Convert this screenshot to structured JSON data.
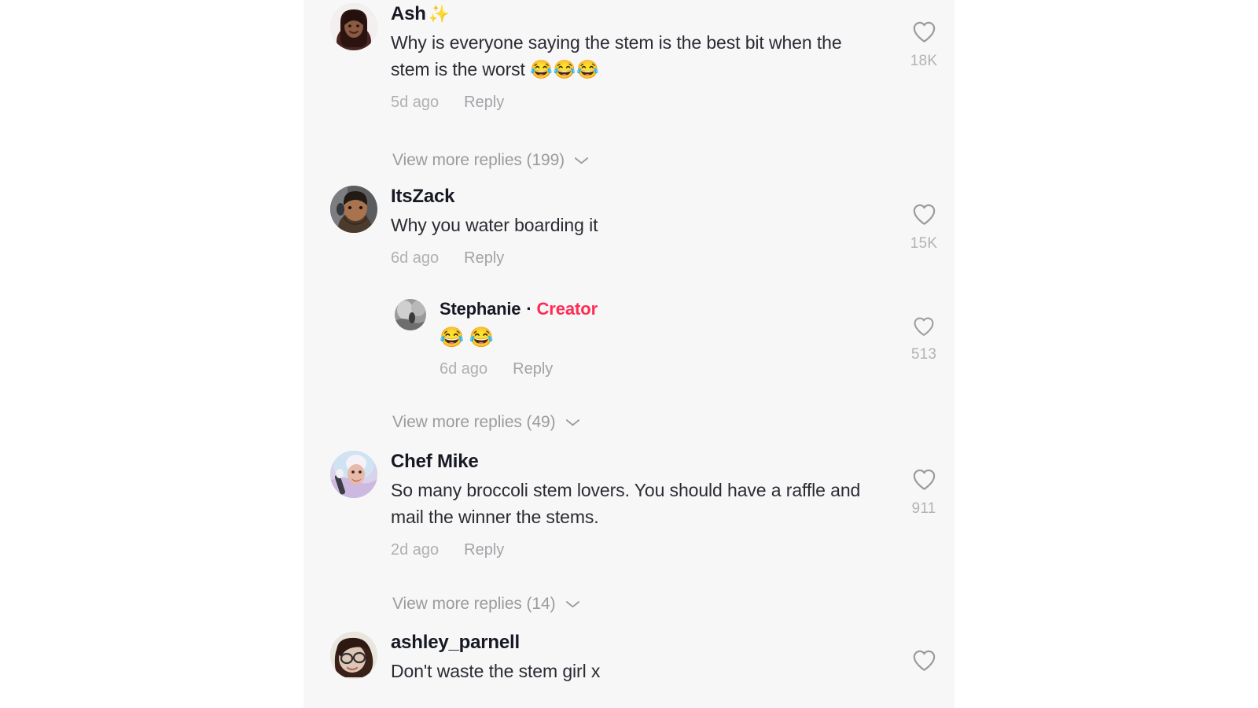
{
  "panel": {
    "background": "#f7f7f7",
    "page_background": "#ffffff",
    "accent_creator": "#fe2c55"
  },
  "comments": [
    {
      "id": "ash",
      "username": "Ash",
      "name_emoji": "✨",
      "text": "Why is everyone saying the stem is the best bit when the stem is the worst ",
      "text_emoji": "😂😂😂",
      "time": "5d ago",
      "reply_label": "Reply",
      "like_count": "18K",
      "view_more": "View more replies (199)",
      "is_creator": false,
      "creator_label": ""
    },
    {
      "id": "itszack",
      "username": "ItsZack",
      "name_emoji": "",
      "text": "Why you water boarding it",
      "text_emoji": "",
      "time": "6d ago",
      "reply_label": "Reply",
      "like_count": "15K",
      "view_more": "",
      "is_creator": false,
      "creator_label": ""
    },
    {
      "id": "stephanie",
      "username": "Stephanie",
      "name_emoji": "",
      "text": "",
      "text_emoji": "😂 😂",
      "time": "6d ago",
      "reply_label": "Reply",
      "like_count": "513",
      "view_more": "View more replies (49)",
      "is_creator": true,
      "creator_label": "Creator",
      "separator": "·"
    },
    {
      "id": "chefmike",
      "username": "Chef Mike",
      "name_emoji": "",
      "text": "So many broccoli stem lovers. You should have a raffle and mail the winner the stems.",
      "text_emoji": "",
      "time": "2d ago",
      "reply_label": "Reply",
      "like_count": "911",
      "view_more": "View more replies (14)",
      "is_creator": false,
      "creator_label": ""
    },
    {
      "id": "ashley_parnell",
      "username": "ashley_parnell",
      "name_emoji": "",
      "text": "Don't waste the stem girl x",
      "text_emoji": "",
      "time": "",
      "reply_label": "",
      "like_count": "",
      "view_more": "",
      "is_creator": false,
      "creator_label": ""
    }
  ],
  "icons": {
    "heart": "heart-outline-icon",
    "chevron": "chevron-down-icon"
  }
}
